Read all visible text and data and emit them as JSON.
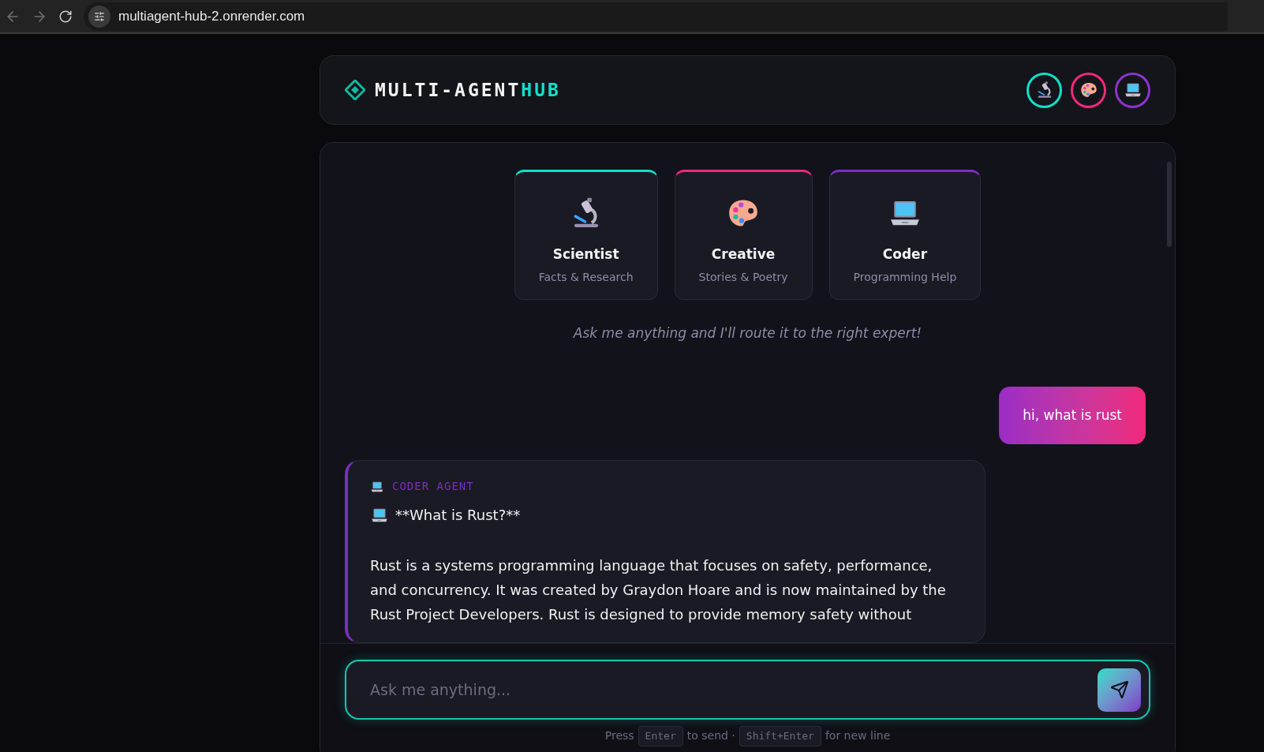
{
  "browser": {
    "url": "multiagent-hub-2.onrender.com"
  },
  "header": {
    "logo_text": "MULTI-AGENT",
    "logo_accent": "HUB",
    "agent_buttons": [
      {
        "kind": "scientist",
        "color": "#10e0c8"
      },
      {
        "kind": "creative",
        "color": "#f0287a"
      },
      {
        "kind": "coder",
        "color": "#8a35c8"
      }
    ]
  },
  "agent_cards": [
    {
      "kind": "scientist",
      "title": "Scientist",
      "subtitle": "Facts & Research",
      "color": "#10e0c8"
    },
    {
      "kind": "creative",
      "title": "Creative",
      "subtitle": "Stories & Poetry",
      "color": "#f0287a"
    },
    {
      "kind": "coder",
      "title": "Coder",
      "subtitle": "Programming Help",
      "color": "#7b2fbe"
    }
  ],
  "intro": "Ask me anything and I'll route it to the right expert!",
  "messages": [
    {
      "kind": "user",
      "text": "hi, what is rust"
    },
    {
      "kind": "agent",
      "avatar": {
        "kind": "coder"
      },
      "label": "CODER AGENT",
      "color": "#7b2fbe",
      "heading": "**What is Rust?**",
      "paragraphs": [
        "Rust is a systems programming language that focuses on safety, performance, and concurrency. It was created by Graydon Hoare and is now maintained by the Rust Project Developers. Rust is designed to provide memory safety without"
      ]
    }
  ],
  "composer": {
    "placeholder": "Ask me anything...",
    "hint_parts": [
      {
        "kind": "text",
        "text": "Press"
      },
      {
        "kind": "key",
        "text": "Enter"
      },
      {
        "kind": "text",
        "text": "to send ·"
      },
      {
        "kind": "key",
        "text": "Shift+Enter"
      },
      {
        "kind": "text",
        "text": "for new line"
      }
    ]
  }
}
